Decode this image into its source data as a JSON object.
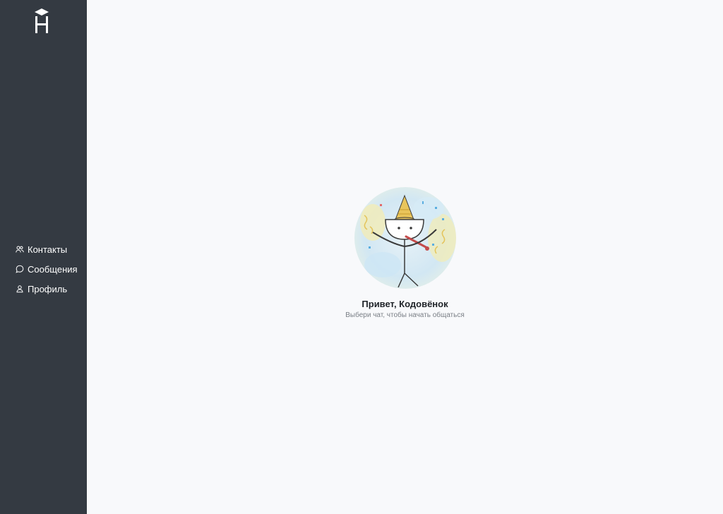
{
  "app": {
    "logo_icon": "hexlet-h-logo-icon"
  },
  "sidebar": {
    "items": [
      {
        "label": "Контакты",
        "icon": "contacts-icon"
      },
      {
        "label": "Сообщения",
        "icon": "chat-bubble-icon"
      },
      {
        "label": "Профиль",
        "icon": "user-icon"
      }
    ]
  },
  "main": {
    "greeting": "Привет, Кодовёнок",
    "subtitle": "Выбери чат, чтобы начать общаться",
    "illustration_icon": "party-stick-figure-illustration"
  },
  "colors": {
    "sidebar_bg": "#343a42",
    "main_bg": "#f8f9fb",
    "nav_text": "#ffffff"
  }
}
